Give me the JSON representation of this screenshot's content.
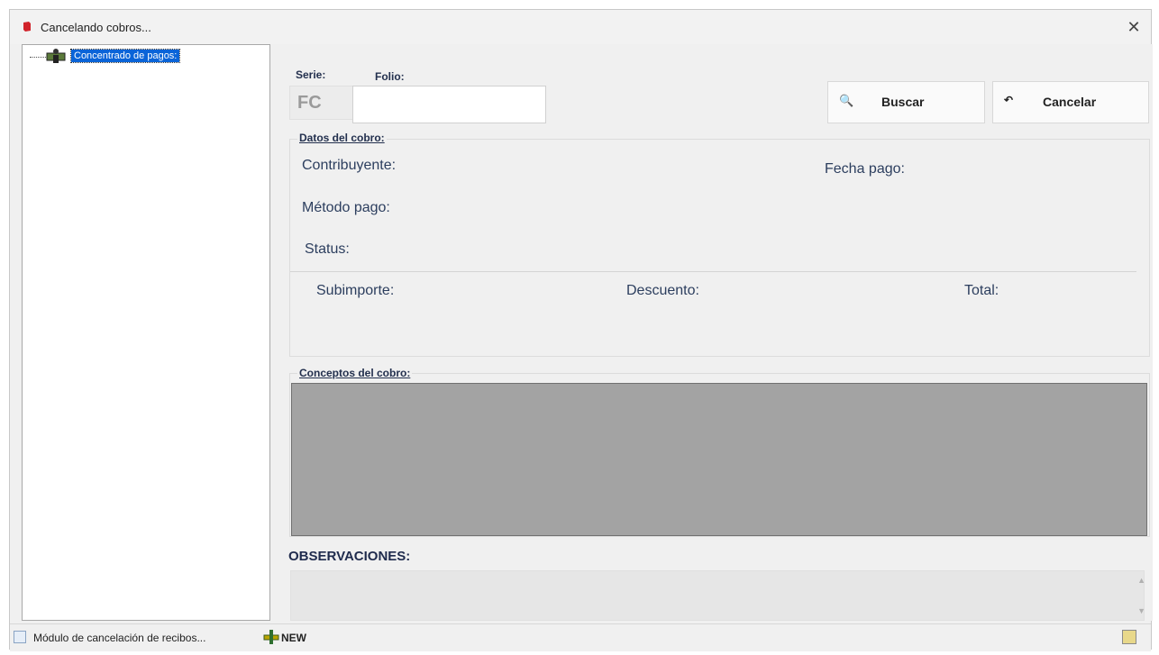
{
  "window": {
    "title": "Cancelando cobros..."
  },
  "tree": {
    "root_label": "Concentrado de pagos:"
  },
  "search": {
    "serie_label": "Serie:",
    "folio_label": "Folio:",
    "serie_value": "FC",
    "folio_value": "",
    "buscar_label": "Buscar",
    "cancelar_label": "Cancelar"
  },
  "datos": {
    "title": "Datos del cobro:",
    "contribuyente_label": "Contribuyente:",
    "fecha_pago_label": "Fecha pago:",
    "metodo_pago_label": "Método pago:",
    "status_label": "Status:",
    "subimporte_label": "Subimporte:",
    "descuento_label": "Descuento:",
    "total_label": "Total:"
  },
  "conceptos": {
    "title": "Conceptos del cobro:"
  },
  "observaciones": {
    "title": "OBSERVACIONES:",
    "value": ""
  },
  "statusbar": {
    "module_text": "Módulo de cancelación de recibos...",
    "new_text": "NEW"
  },
  "icons": {
    "app": "red-book-icon",
    "tree": "money-person-icon",
    "buscar": "binoculars-icon",
    "cancelar": "undo-icon",
    "close": "close-icon"
  },
  "colors": {
    "selection": "#0a64d8",
    "label_text": "#2c3e5e",
    "grid_bg": "#a3a3a3"
  }
}
